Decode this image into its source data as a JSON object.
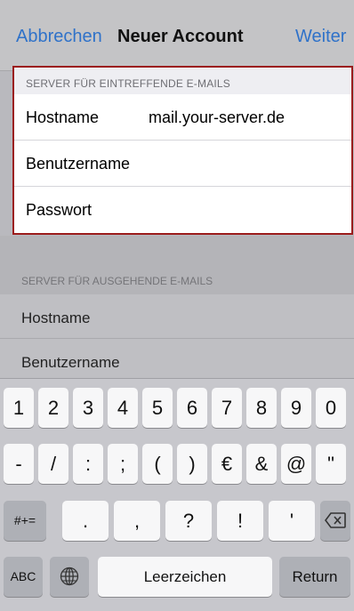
{
  "nav": {
    "cancel_label": "Abbrechen",
    "title": "Neuer Account",
    "next_label": "Weiter"
  },
  "incoming": {
    "header": "SERVER FÜR EINTREFFENDE E-MAILS",
    "hostname_label": "Hostname",
    "hostname_value": "mail.your-server.de",
    "username_label": "Benutzername",
    "password_label": "Passwort"
  },
  "outgoing": {
    "header": "SERVER FÜR AUSGEHENDE E-MAILS",
    "hostname_label": "Hostname",
    "username_label": "Benutzername"
  },
  "keyboard": {
    "row1": [
      "1",
      "2",
      "3",
      "4",
      "5",
      "6",
      "7",
      "8",
      "9",
      "0"
    ],
    "row2": [
      "-",
      "/",
      ":",
      ";",
      "(",
      ")",
      "€",
      "&",
      "@",
      "\""
    ],
    "row3": [
      ".",
      ",",
      "?",
      "!",
      "'"
    ],
    "symbols_label": "#+=",
    "backspace_icon": "backspace-icon",
    "abc_label": "ABC",
    "globe_icon": "globe-icon",
    "space_label": "Leerzeichen",
    "return_label": "Return"
  },
  "colors": {
    "accent": "#2f72c9",
    "highlight_border": "#9b1c1c"
  }
}
